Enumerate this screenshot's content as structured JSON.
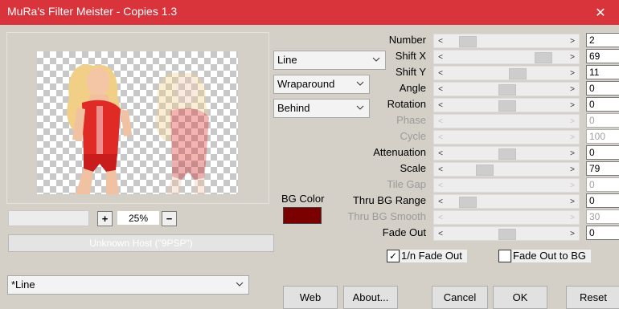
{
  "window": {
    "title": "MuRa's Filter Meister - Copies 1.3",
    "close_symbol": "✕"
  },
  "preview": {
    "zoom_value": "25%",
    "zoom_in": "+",
    "zoom_out": "−"
  },
  "host": {
    "text": "Unknown Host (\"9PSP\")"
  },
  "preset": {
    "value": "*Line"
  },
  "dropdowns": {
    "mode": "Line",
    "edge": "Wraparound",
    "order": "Behind"
  },
  "bg_color": {
    "label": "BG Color",
    "color": "#7b0000"
  },
  "params": [
    {
      "label": "Number",
      "value": "2",
      "level": 0.12,
      "enabled": true
    },
    {
      "label": "Shift X",
      "value": "69",
      "level": 0.85,
      "enabled": true
    },
    {
      "label": "Shift Y",
      "value": "11",
      "level": 0.6,
      "enabled": true
    },
    {
      "label": "Angle",
      "value": "0",
      "level": 0.5,
      "enabled": true
    },
    {
      "label": "Rotation",
      "value": "0",
      "level": 0.5,
      "enabled": true
    },
    {
      "label": "Phase",
      "value": "0",
      "level": null,
      "enabled": false
    },
    {
      "label": "Cycle",
      "value": "100",
      "level": null,
      "enabled": false
    },
    {
      "label": "Attenuation",
      "value": "0",
      "level": 0.5,
      "enabled": true
    },
    {
      "label": "Scale",
      "value": "79",
      "level": 0.28,
      "enabled": true
    },
    {
      "label": "Tile Gap",
      "value": "0",
      "level": null,
      "enabled": false
    },
    {
      "label": "Thru BG Range",
      "value": "0",
      "level": 0.12,
      "enabled": true
    },
    {
      "label": "Thru BG Smooth",
      "value": "30",
      "level": null,
      "enabled": false
    },
    {
      "label": "Fade Out",
      "value": "0",
      "level": 0.5,
      "enabled": true
    }
  ],
  "checkboxes": {
    "fade_1n": {
      "label": "1/n Fade Out",
      "checked": true,
      "mark": "✓"
    },
    "fade_bg": {
      "label": "Fade Out to BG",
      "checked": false
    }
  },
  "buttons": {
    "web": "Web",
    "about": "About...",
    "cancel": "Cancel",
    "ok": "OK",
    "reset": "Reset"
  }
}
